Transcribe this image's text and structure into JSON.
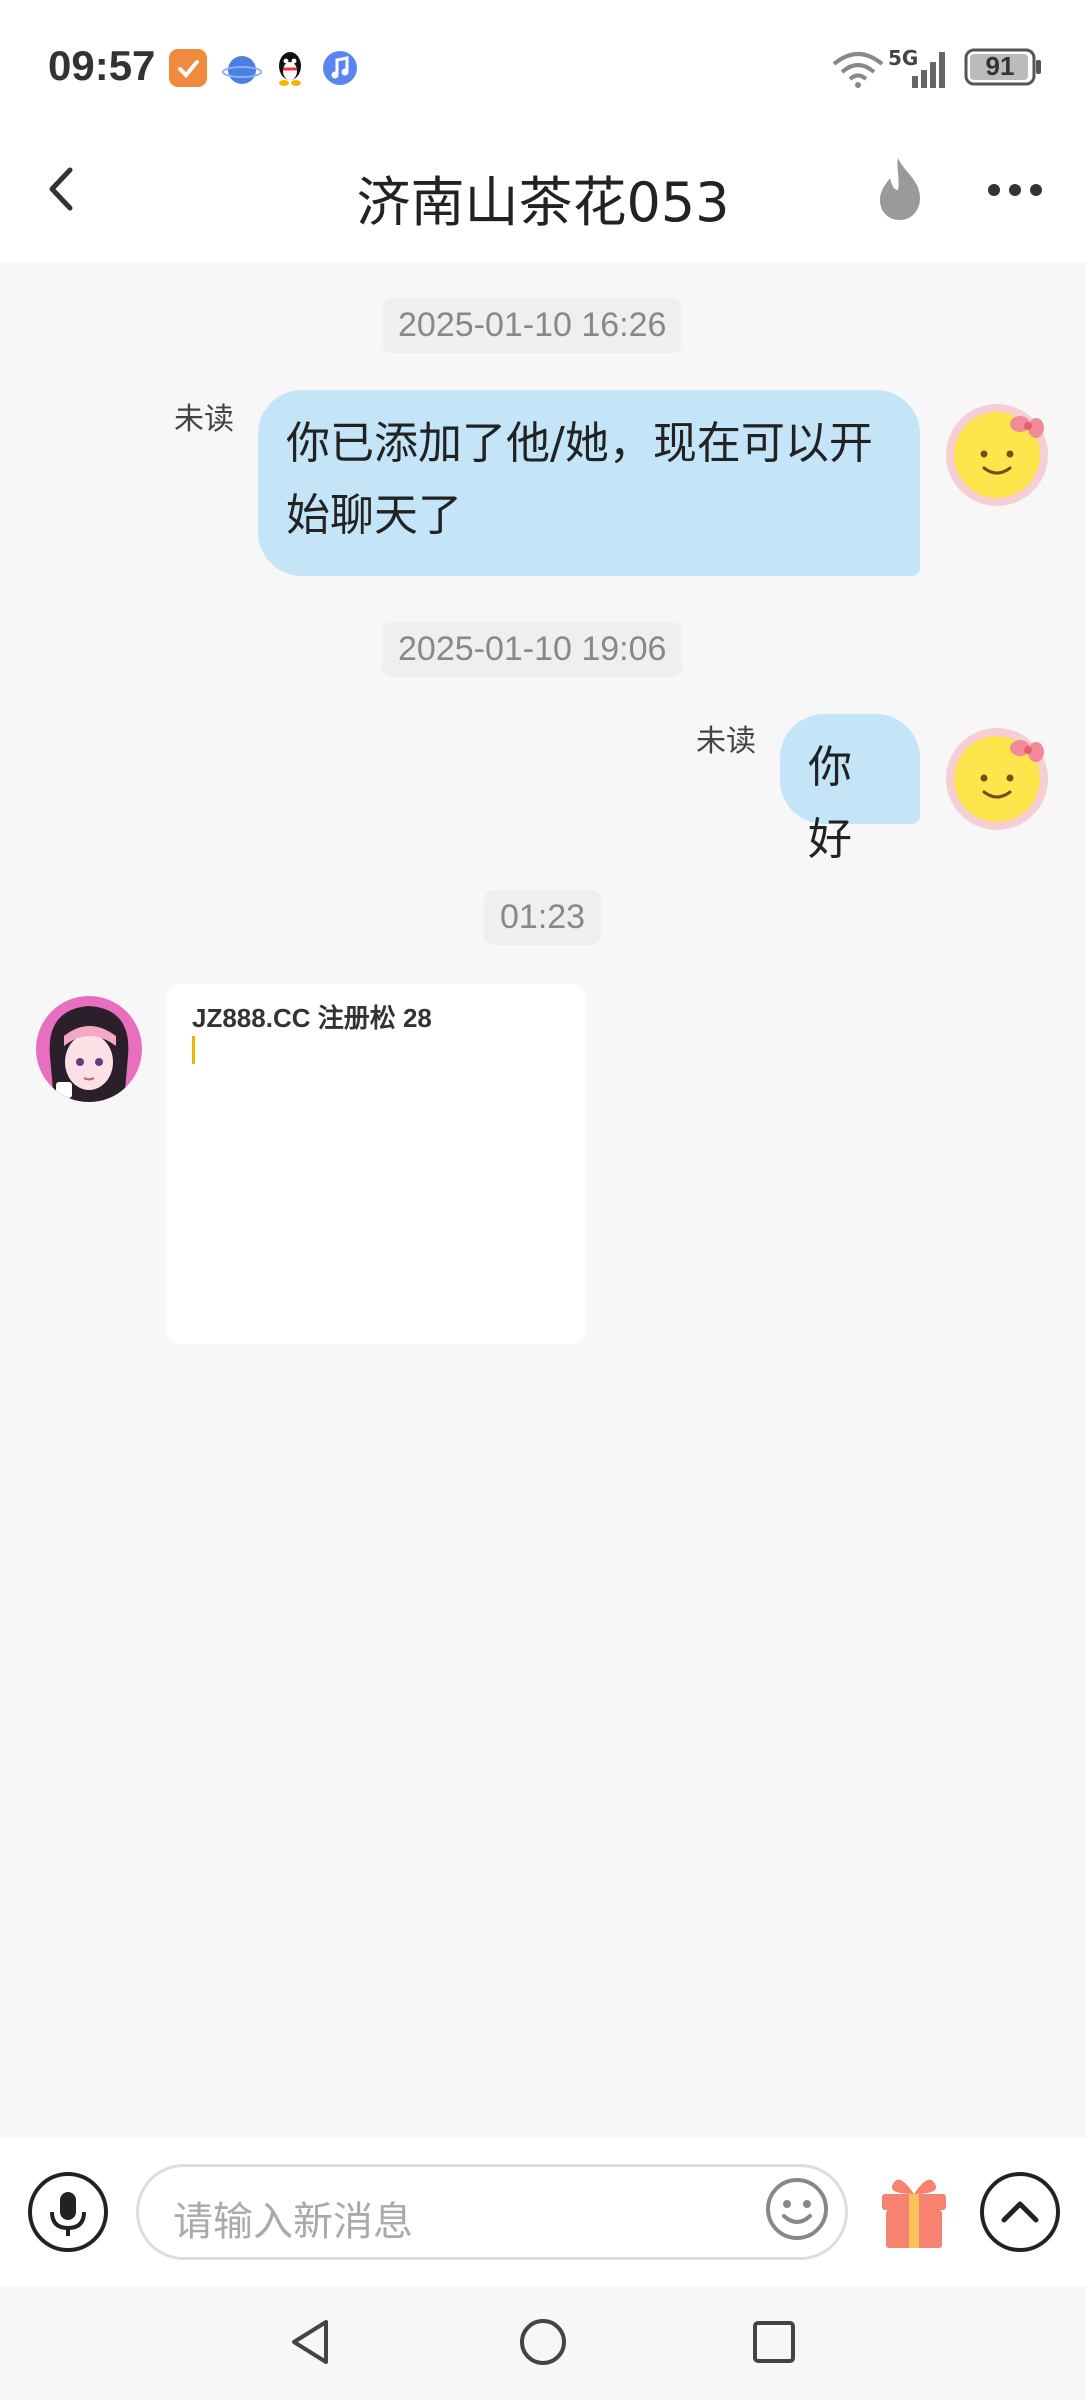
{
  "status_bar": {
    "time": "09:57",
    "network": "5G",
    "battery": "91",
    "notification_icons": [
      "shield-app-icon",
      "blue-dot-app-icon",
      "qq-penguin-icon",
      "music-app-icon"
    ]
  },
  "header": {
    "title": "济南山茶花053",
    "icons": [
      "back-arrow-icon",
      "fire-icon",
      "more-dots-icon"
    ]
  },
  "messages": [
    {
      "timestamp": "2025-01-10 16:26",
      "status": "未读",
      "lines": [
        "你已添加了他/她，现在可以开",
        "始聊天了"
      ],
      "sender": "self"
    },
    {
      "timestamp": "2025-01-10 19:06",
      "status": "未读",
      "lines": [
        "你好"
      ],
      "sender": "self"
    },
    {
      "timestamp": "01:23",
      "card_text": "JZ888.CC 注册松 28",
      "sender": "other"
    }
  ],
  "input_bar": {
    "placeholder": "请输入新消息",
    "icons": [
      "microphone-icon",
      "emoji-icon",
      "gift-icon",
      "chevron-up-icon"
    ]
  },
  "nav_bar": {
    "icons": [
      "back-triangle-icon",
      "home-circle-icon",
      "recents-square-icon"
    ]
  },
  "colors": {
    "bubble_out": "#c3e5f7",
    "background": "#f7f7f7",
    "header": "#ffffff"
  }
}
